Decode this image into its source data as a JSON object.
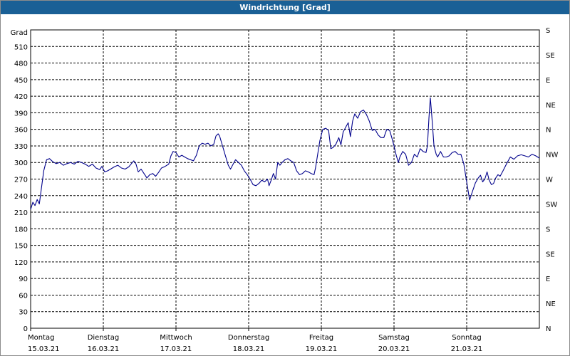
{
  "window": {
    "title": "Windrichtung [Grad]"
  },
  "chart_data": {
    "type": "line",
    "title": "Windrichtung [Grad]",
    "ylabel": "Grad",
    "ylim": [
      0,
      540
    ],
    "y_ticks": [
      0,
      30,
      60,
      90,
      120,
      150,
      180,
      210,
      240,
      270,
      300,
      330,
      360,
      390,
      420,
      450,
      480,
      510
    ],
    "right_axis_labels": [
      "N",
      "NE",
      "E",
      "SE",
      "S",
      "SW",
      "W",
      "NW",
      "N",
      "NE",
      "E",
      "SE",
      "S"
    ],
    "grid": true,
    "x_range": [
      0,
      7
    ],
    "x_tick_labels": [
      {
        "x": 0,
        "day": "Montag",
        "date": "15.03.21"
      },
      {
        "x": 1,
        "day": "Dienstag",
        "date": "16.03.21"
      },
      {
        "x": 2,
        "day": "Mittwoch",
        "date": "17.03.21"
      },
      {
        "x": 3,
        "day": "Donnerstag",
        "date": "18.03.21"
      },
      {
        "x": 4,
        "day": "Freitag",
        "date": "19.03.21"
      },
      {
        "x": 5,
        "day": "Samstag",
        "date": "20.03.21"
      },
      {
        "x": 6,
        "day": "Sonntag",
        "date": "21.03.21"
      }
    ],
    "series": [
      {
        "color": "#00008b",
        "points": [
          [
            0.0,
            215
          ],
          [
            0.03,
            228
          ],
          [
            0.06,
            222
          ],
          [
            0.09,
            233
          ],
          [
            0.12,
            225
          ],
          [
            0.15,
            255
          ],
          [
            0.18,
            285
          ],
          [
            0.22,
            305
          ],
          [
            0.26,
            307
          ],
          [
            0.3,
            302
          ],
          [
            0.35,
            298
          ],
          [
            0.4,
            300
          ],
          [
            0.45,
            295
          ],
          [
            0.5,
            298
          ],
          [
            0.55,
            300
          ],
          [
            0.6,
            297
          ],
          [
            0.65,
            302
          ],
          [
            0.7,
            300
          ],
          [
            0.75,
            297
          ],
          [
            0.8,
            293
          ],
          [
            0.85,
            297
          ],
          [
            0.9,
            290
          ],
          [
            0.95,
            287
          ],
          [
            0.98,
            293
          ],
          [
            1.02,
            283
          ],
          [
            1.06,
            285
          ],
          [
            1.1,
            288
          ],
          [
            1.15,
            292
          ],
          [
            1.2,
            295
          ],
          [
            1.25,
            290
          ],
          [
            1.3,
            288
          ],
          [
            1.35,
            292
          ],
          [
            1.4,
            300
          ],
          [
            1.42,
            303
          ],
          [
            1.45,
            297
          ],
          [
            1.48,
            283
          ],
          [
            1.52,
            288
          ],
          [
            1.56,
            280
          ],
          [
            1.6,
            272
          ],
          [
            1.64,
            278
          ],
          [
            1.68,
            280
          ],
          [
            1.72,
            275
          ],
          [
            1.76,
            282
          ],
          [
            1.8,
            290
          ],
          [
            1.85,
            293
          ],
          [
            1.9,
            297
          ],
          [
            1.93,
            312
          ],
          [
            1.96,
            320
          ],
          [
            2.0,
            318
          ],
          [
            2.04,
            310
          ],
          [
            2.08,
            313
          ],
          [
            2.12,
            310
          ],
          [
            2.16,
            307
          ],
          [
            2.2,
            305
          ],
          [
            2.24,
            303
          ],
          [
            2.28,
            313
          ],
          [
            2.32,
            330
          ],
          [
            2.36,
            335
          ],
          [
            2.4,
            333
          ],
          [
            2.44,
            335
          ],
          [
            2.48,
            330
          ],
          [
            2.52,
            333
          ],
          [
            2.55,
            348
          ],
          [
            2.58,
            352
          ],
          [
            2.6,
            348
          ],
          [
            2.64,
            330
          ],
          [
            2.68,
            312
          ],
          [
            2.72,
            295
          ],
          [
            2.75,
            288
          ],
          [
            2.79,
            298
          ],
          [
            2.82,
            305
          ],
          [
            2.86,
            300
          ],
          [
            2.9,
            295
          ],
          [
            2.94,
            285
          ],
          [
            2.98,
            278
          ],
          [
            3.02,
            270
          ],
          [
            3.06,
            260
          ],
          [
            3.1,
            258
          ],
          [
            3.14,
            262
          ],
          [
            3.18,
            268
          ],
          [
            3.22,
            265
          ],
          [
            3.26,
            270
          ],
          [
            3.28,
            258
          ],
          [
            3.31,
            268
          ],
          [
            3.34,
            280
          ],
          [
            3.37,
            270
          ],
          [
            3.4,
            300
          ],
          [
            3.43,
            295
          ],
          [
            3.46,
            300
          ],
          [
            3.5,
            305
          ],
          [
            3.54,
            307
          ],
          [
            3.58,
            303
          ],
          [
            3.62,
            300
          ],
          [
            3.66,
            285
          ],
          [
            3.7,
            278
          ],
          [
            3.74,
            280
          ],
          [
            3.78,
            285
          ],
          [
            3.82,
            283
          ],
          [
            3.86,
            280
          ],
          [
            3.9,
            278
          ],
          [
            3.92,
            290
          ],
          [
            3.95,
            315
          ],
          [
            3.98,
            340
          ],
          [
            4.02,
            360
          ],
          [
            4.06,
            362
          ],
          [
            4.1,
            358
          ],
          [
            4.13,
            325
          ],
          [
            4.16,
            327
          ],
          [
            4.2,
            333
          ],
          [
            4.24,
            345
          ],
          [
            4.27,
            332
          ],
          [
            4.3,
            355
          ],
          [
            4.34,
            365
          ],
          [
            4.37,
            372
          ],
          [
            4.4,
            347
          ],
          [
            4.43,
            375
          ],
          [
            4.46,
            388
          ],
          [
            4.5,
            380
          ],
          [
            4.54,
            392
          ],
          [
            4.58,
            395
          ],
          [
            4.62,
            387
          ],
          [
            4.66,
            375
          ],
          [
            4.7,
            358
          ],
          [
            4.74,
            360
          ],
          [
            4.78,
            350
          ],
          [
            4.82,
            345
          ],
          [
            4.86,
            345
          ],
          [
            4.9,
            360
          ],
          [
            4.94,
            358
          ],
          [
            4.97,
            345
          ],
          [
            5.0,
            330
          ],
          [
            5.03,
            313
          ],
          [
            5.06,
            300
          ],
          [
            5.08,
            310
          ],
          [
            5.12,
            320
          ],
          [
            5.16,
            315
          ],
          [
            5.2,
            295
          ],
          [
            5.24,
            300
          ],
          [
            5.28,
            315
          ],
          [
            5.32,
            310
          ],
          [
            5.36,
            325
          ],
          [
            5.4,
            320
          ],
          [
            5.44,
            318
          ],
          [
            5.46,
            330
          ],
          [
            5.48,
            380
          ],
          [
            5.5,
            417
          ],
          [
            5.52,
            385
          ],
          [
            5.55,
            330
          ],
          [
            5.58,
            315
          ],
          [
            5.6,
            310
          ],
          [
            5.64,
            320
          ],
          [
            5.68,
            310
          ],
          [
            5.72,
            310
          ],
          [
            5.76,
            312
          ],
          [
            5.8,
            318
          ],
          [
            5.84,
            320
          ],
          [
            5.88,
            315
          ],
          [
            5.92,
            315
          ],
          [
            5.96,
            298
          ],
          [
            6.0,
            265
          ],
          [
            6.04,
            232
          ],
          [
            6.08,
            248
          ],
          [
            6.12,
            263
          ],
          [
            6.16,
            272
          ],
          [
            6.19,
            277
          ],
          [
            6.22,
            265
          ],
          [
            6.25,
            270
          ],
          [
            6.28,
            283
          ],
          [
            6.31,
            268
          ],
          [
            6.34,
            260
          ],
          [
            6.37,
            262
          ],
          [
            6.4,
            272
          ],
          [
            6.43,
            278
          ],
          [
            6.46,
            275
          ],
          [
            6.5,
            285
          ],
          [
            6.55,
            298
          ],
          [
            6.6,
            310
          ],
          [
            6.65,
            306
          ],
          [
            6.7,
            312
          ],
          [
            6.75,
            314
          ],
          [
            6.8,
            312
          ],
          [
            6.85,
            310
          ],
          [
            6.9,
            315
          ],
          [
            6.95,
            312
          ],
          [
            7.0,
            308
          ]
        ]
      }
    ]
  }
}
